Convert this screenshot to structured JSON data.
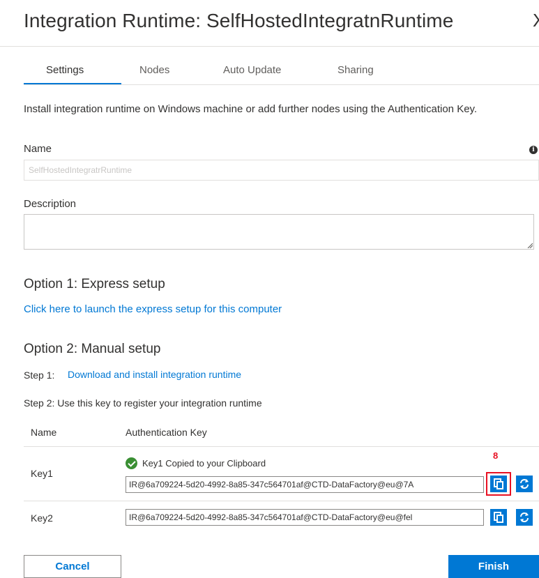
{
  "header": {
    "title": "Integration Runtime: SelfHostedIntegratnRuntime",
    "close_glyph": "X"
  },
  "tabs": [
    {
      "label": "Settings",
      "active": true
    },
    {
      "label": "Nodes",
      "active": false
    },
    {
      "label": "Auto Update",
      "active": false
    },
    {
      "label": "Sharing",
      "active": false
    }
  ],
  "intro": "Install integration runtime on Windows machine or add further nodes using the Authentication Key.",
  "name_field": {
    "label": "Name",
    "value": "SelfHostedIntegratrRuntime",
    "info_glyph": "i"
  },
  "description_field": {
    "label": "Description",
    "value": ""
  },
  "option1": {
    "heading": "Option 1: Express setup",
    "link": "Click here to launch the express setup for this computer"
  },
  "option2": {
    "heading": "Option 2: Manual setup",
    "step1_prefix": "Step 1:",
    "step1_link": "Download and install integration runtime",
    "step2": "Step 2: Use this key to register your integration runtime"
  },
  "keys_table": {
    "headers": [
      "Name",
      "Authentication Key"
    ],
    "rows": [
      {
        "name": "Key1",
        "status": "Key1 Copied to your Clipboard",
        "value": "IR@6a709224-5d20-4992-8a85-347c564701af@CTD-DataFactory@eu@7A"
      },
      {
        "name": "Key2",
        "value": "IR@6a709224-5d20-4992-8a85-347c564701af@CTD-DataFactory@eu@fel"
      }
    ]
  },
  "annotation": "8",
  "buttons": {
    "cancel": "Cancel",
    "finish": "Finish"
  },
  "colors": {
    "accent": "#0078d4",
    "success": "#3a8f33",
    "highlight": "#e81123"
  }
}
